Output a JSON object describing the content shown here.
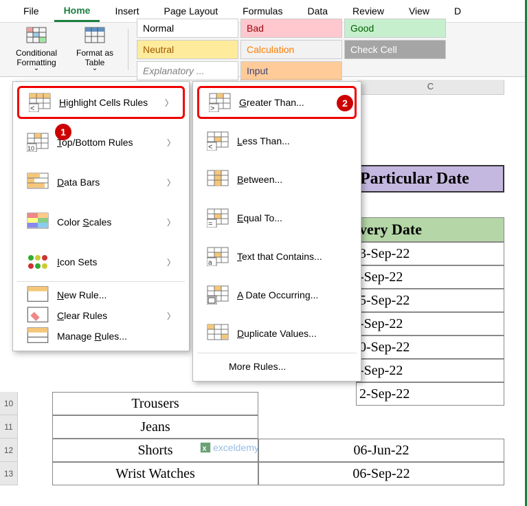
{
  "menu": {
    "file": "File",
    "home": "Home",
    "insert": "Insert",
    "pagelayout": "Page Layout",
    "formulas": "Formulas",
    "data": "Data",
    "review": "Review",
    "view": "View",
    "d": "D"
  },
  "ribbon": {
    "condfmt": "Conditional Formatting",
    "ftable": "Format as Table",
    "chevron": "⌄"
  },
  "styles": {
    "normal": "Normal",
    "bad": "Bad",
    "good": "Good",
    "neutral": "Neutral",
    "calc": "Calculation",
    "check": "Check Cell",
    "expl": "Explanatory ...",
    "input": "Input"
  },
  "colhdr": {
    "c": "C"
  },
  "rows": {
    "r10": "10",
    "r11": "11",
    "r12": "12",
    "r13": "13"
  },
  "banner": " Particular Date",
  "header2": "very Date",
  "data": {
    "b10": "Trousers",
    "b11": "Jeans",
    "b12": "Shorts",
    "b13": "Wrist Watches",
    "c5_p": "3-Sep-22",
    "c6_p": "-Sep-22",
    "c7_p": "5-Sep-22",
    "c8_p": "-Sep-22",
    "c9_p": "0-Sep-22",
    "c10_p": "-Sep-22",
    "c11_p": "2-Sep-22",
    "c12": "06-Jun-22",
    "c13": "06-Sep-22"
  },
  "menu1": {
    "highlight": "Highlight Cells Rules",
    "topbottom": "Top/Bottom Rules",
    "databars": "Data Bars",
    "colorscales": "Color Scales",
    "iconsets": "Icon Sets",
    "newrule": "New Rule...",
    "clear": "Clear Rules",
    "manage": "Manage Rules..."
  },
  "menu2": {
    "gt": "Greater Than...",
    "lt": "Less Than...",
    "between": "Between...",
    "equal": "Equal To...",
    "text": "Text that Contains...",
    "date": "A Date Occurring...",
    "dup": "Duplicate Values...",
    "more": "More Rules..."
  },
  "badges": {
    "b1": "1",
    "b2": "2"
  },
  "watermark": "exceldemy"
}
